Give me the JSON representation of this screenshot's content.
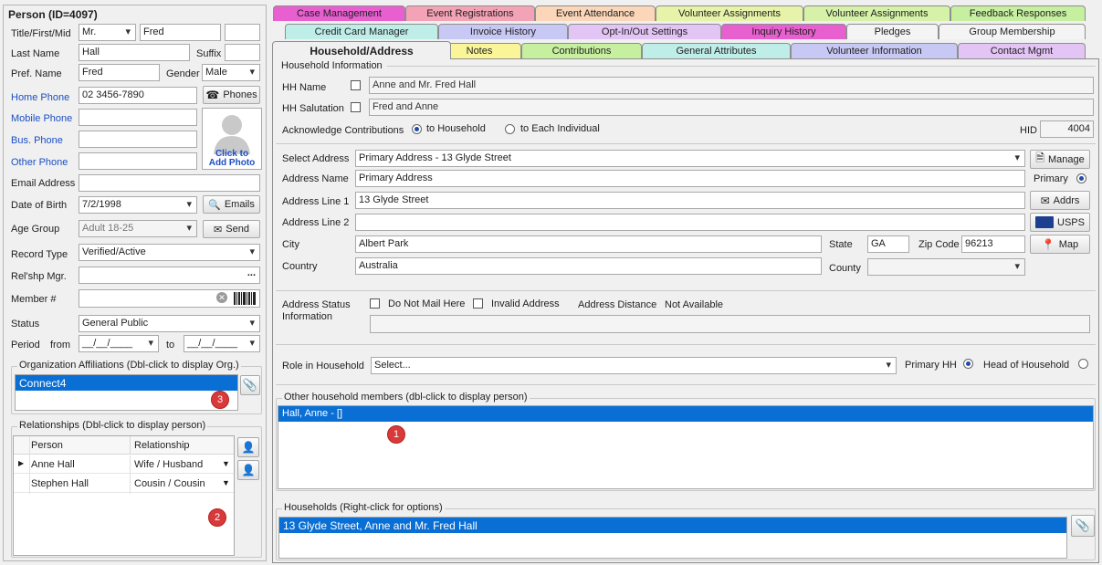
{
  "person": {
    "header": "Person (ID=4097)",
    "labels": {
      "title_first_mid": "Title/First/Mid",
      "last_name": "Last Name",
      "suffix": "Suffix",
      "pref_name": "Pref. Name",
      "gender": "Gender",
      "home_phone": "Home Phone",
      "mobile_phone": "Mobile Phone",
      "bus_phone": "Bus. Phone",
      "other_phone": "Other Phone",
      "email": "Email Address",
      "dob": "Date of Birth",
      "age_group": "Age Group",
      "record_type": "Record Type",
      "relship_mgr": "Rel'shp Mgr.",
      "member": "Member #",
      "status": "Status",
      "period": "Period",
      "from": "from",
      "to": "to"
    },
    "values": {
      "title": "Mr.",
      "first": "Fred",
      "mid": "",
      "last": "Hall",
      "suffix": "",
      "pref": "Fred",
      "gender": "Male",
      "home_phone": "02 3456-7890",
      "mobile_phone": "",
      "bus_phone": "",
      "other_phone": "",
      "email": "",
      "dob": "7/2/1998",
      "age_group": "Adult 18-25",
      "record_type": "Verified/Active",
      "relship_mgr": "",
      "member": "",
      "status": "General Public",
      "period_from": "__/__/____",
      "period_to": "__/__/____"
    },
    "buttons": {
      "phones": "Phones",
      "emails": "Emails",
      "send": "Send",
      "ellipsis": "..."
    },
    "photo": {
      "line1": "Click to",
      "line2": "Add Photo"
    },
    "org_affiliations": {
      "title": "Organization Affiliations (Dbl-click to display Org.)",
      "items": [
        "Connect4"
      ],
      "badge": "3"
    },
    "relationships": {
      "title": "Relationships (Dbl-click to display person)",
      "columns": [
        "Person",
        "Relationship"
      ],
      "rows": [
        {
          "person": "Anne Hall",
          "relationship": "Wife / Husband"
        },
        {
          "person": "Stephen Hall",
          "relationship": "Cousin / Cousin"
        }
      ],
      "badge": "2"
    }
  },
  "tabs": {
    "row1": [
      "Case Management",
      "Event Registrations",
      "Event Attendance",
      "Volunteer Assignments",
      "Volunteer Assignments",
      "Feedback Responses"
    ],
    "row2": [
      "Credit Card Manager",
      "Invoice History",
      "Opt-In/Out Settings",
      "Inquiry History",
      "Pledges",
      "Group Membership"
    ],
    "row3": [
      "Household/Address",
      "Notes",
      "Contributions",
      "General Attributes",
      "Volunteer Information",
      "Contact Mgmt"
    ]
  },
  "household": {
    "section_title": "Household Information",
    "hh_name_label": "HH Name",
    "hh_name": "Anne and Mr. Fred Hall",
    "hh_salutation_label": "HH Salutation",
    "hh_salutation": "Fred and Anne",
    "ack_label": "Acknowledge Contributions",
    "ack_household": "to Household",
    "ack_individual": "to Each Individual",
    "hid_label": "HID",
    "hid": "4004"
  },
  "address": {
    "labels": {
      "select": "Select Address",
      "name": "Address Name",
      "line1": "Address Line 1",
      "line2": "Address Line 2",
      "city": "City",
      "state": "State",
      "zip": "Zip Code",
      "country": "Country",
      "county": "County",
      "primary": "Primary"
    },
    "values": {
      "select": "Primary Address - 13 Glyde Street",
      "name": "Primary Address",
      "line1": "13 Glyde Street",
      "line2": "",
      "city": "Albert Park",
      "state": "GA",
      "zip": "96213",
      "country": "Australia",
      "county": ""
    },
    "buttons": {
      "manage": "Manage",
      "addrs": "Addrs",
      "usps": "USPS",
      "map": "Map"
    }
  },
  "status": {
    "label_line1": "Address Status",
    "label_line2": "Information",
    "do_not_mail": "Do Not Mail Here",
    "invalid": "Invalid Address",
    "distance_label": "Address Distance",
    "distance_value": "Not Available"
  },
  "role": {
    "label": "Role in Household",
    "value": "Select...",
    "primary_hh": "Primary HH",
    "head": "Head of Household"
  },
  "members": {
    "title": "Other household members (dbl-click to display person)",
    "items": [
      "Hall, Anne  -  []"
    ],
    "badge": "1"
  },
  "households": {
    "title": "Households (Right-click for options)",
    "items": [
      "13 Glyde Street, Anne and Mr. Fred Hall"
    ]
  },
  "colors": {
    "selection": "#0a6fd4",
    "tab_pink": "#f3a3b5",
    "tab_magenta": "#e85fd0",
    "tab_green": "#c6f0a0",
    "tab_yellow": "#fbf59a"
  }
}
